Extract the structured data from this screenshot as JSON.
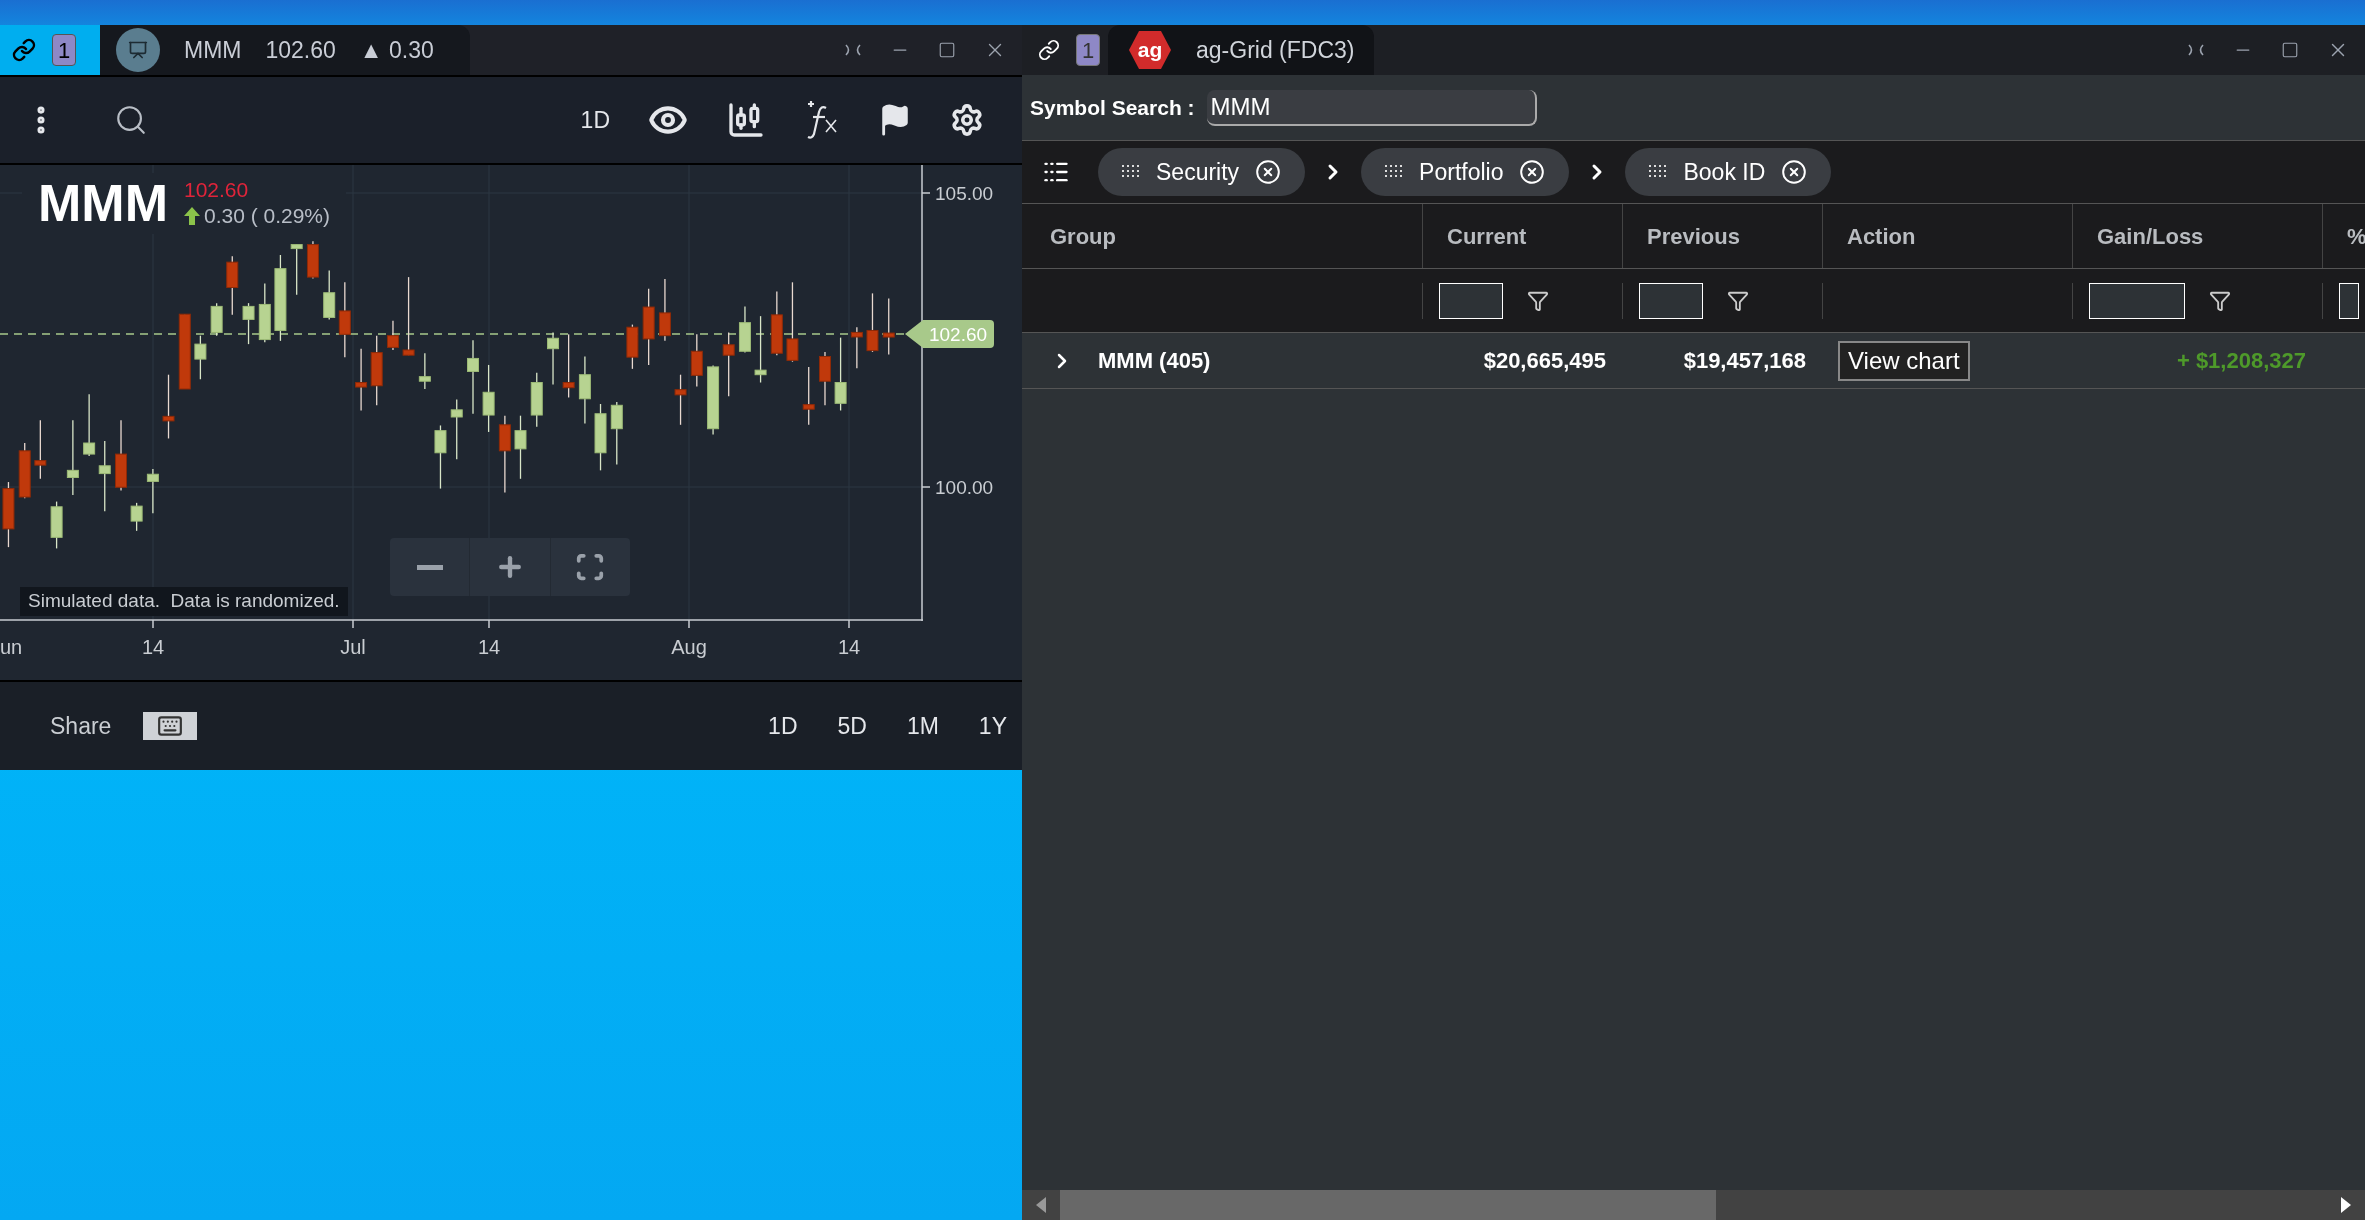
{
  "left_window": {
    "link_badge": "1",
    "tab": {
      "symbol": "MMM",
      "price": "102.60",
      "change": "▲ 0.30"
    },
    "toolbar": {
      "interval": "1D"
    },
    "chart": {
      "symbol": "MMM",
      "price": "102.60",
      "change": "0.30 ( 0.29%)",
      "y_axis": [
        "105.00",
        "100.00"
      ],
      "x_axis": [
        "un",
        "14",
        "Jul",
        "14",
        "Aug",
        "14"
      ],
      "price_tag": "102.60",
      "notice": "Simulated data.  Data is randomized."
    },
    "footer": {
      "share": "Share",
      "ranges": [
        "1D",
        "5D",
        "1M",
        "1Y"
      ]
    }
  },
  "right_window": {
    "link_badge": "1",
    "logo": "ag",
    "title": "ag-Grid (FDC3)",
    "search": {
      "label": "Symbol Search :",
      "value": "MMM"
    },
    "group_chips": [
      "Security",
      "Portfolio",
      "Book ID"
    ],
    "columns": [
      {
        "label": "Group",
        "filter": false
      },
      {
        "label": "Current",
        "filter": true
      },
      {
        "label": "Previous",
        "filter": true
      },
      {
        "label": "Action",
        "filter": false
      },
      {
        "label": "Gain/Loss",
        "filter": true
      },
      {
        "label": "%",
        "filter": true
      }
    ],
    "rows": [
      {
        "group": "MMM (405)",
        "expanded": false,
        "current": "$20,665,495",
        "previous": "$19,457,168",
        "action": "View chart",
        "gain_loss": "+ $1,208,327"
      }
    ]
  }
}
